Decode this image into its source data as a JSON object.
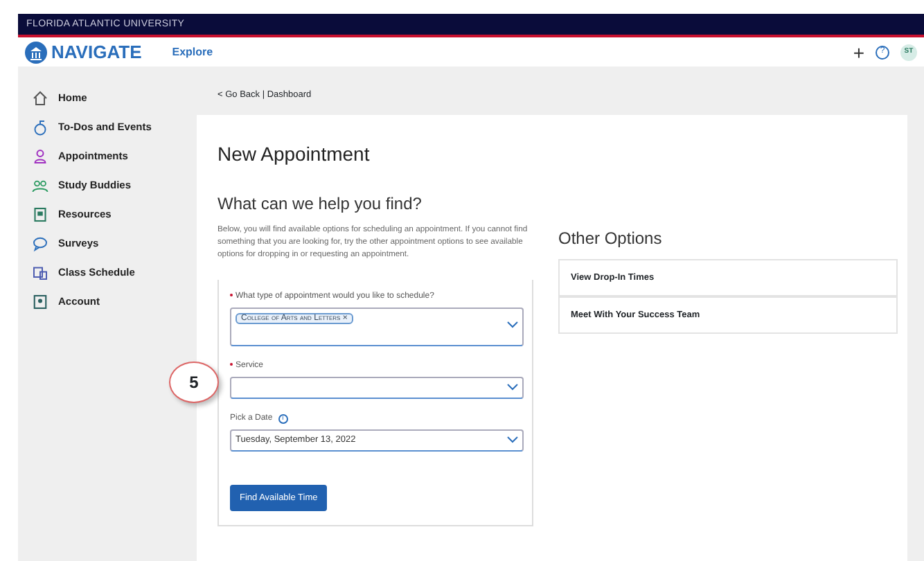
{
  "banner": {
    "title": "FLORIDA ATLANTIC UNIVERSITY"
  },
  "header": {
    "logo": "NAVIGATE",
    "explore": "Explore",
    "plus": "+",
    "help": "?",
    "avatar": "ST"
  },
  "sidebar": {
    "items": [
      {
        "label": "Home"
      },
      {
        "label": "To-Dos and Events"
      },
      {
        "label": "Appointments"
      },
      {
        "label": "Study Buddies"
      },
      {
        "label": "Resources"
      },
      {
        "label": "Surveys"
      },
      {
        "label": "Class Schedule"
      },
      {
        "label": "Account"
      }
    ]
  },
  "breadcrumb": {
    "back": "< Go Back",
    "separator": "|",
    "link": "Dashboard"
  },
  "page": {
    "title": "New Appointment",
    "subtitle": "What can we help you find?",
    "intro": "Below, you will find available options for scheduling an appointment. If you cannot find something that you are looking for, try the other appointment options to see available options for dropping in or requesting an appointment.",
    "callout": "5",
    "fields": [
      {
        "kind": "tags",
        "label": "What type of appointment would you like to schedule?",
        "required": true,
        "tags": [
          {
            "text": "College of Arts and Letters",
            "remove": "×"
          }
        ]
      },
      {
        "kind": "select",
        "label": "Service",
        "required": true
      },
      {
        "kind": "date",
        "label": "Pick a Date",
        "required": false,
        "info": "i",
        "value": "Tuesday, September 13, 2022"
      }
    ],
    "button": "Find Available Time"
  },
  "other_options": {
    "title": "Other Options",
    "links": [
      "View Drop-In Times",
      "Meet With Your Success Team"
    ]
  }
}
